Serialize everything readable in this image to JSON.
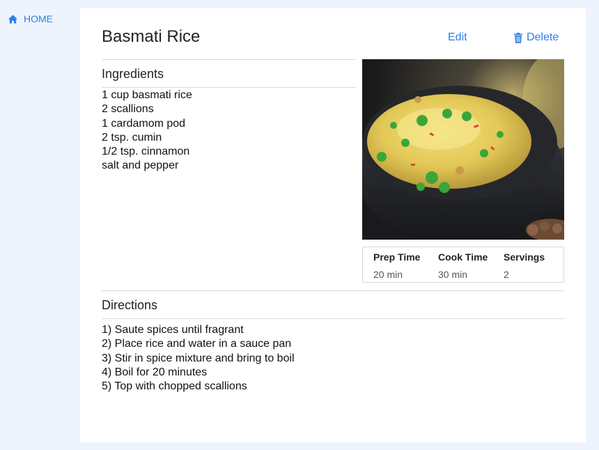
{
  "nav": {
    "home_label": "HOME"
  },
  "recipe": {
    "title": "Basmati Rice",
    "edit_label": "Edit",
    "delete_label": "Delete",
    "ingredients_heading": "Ingredients",
    "ingredients": [
      "1 cup basmati rice",
      "2 scallions",
      "1 cardamom pod",
      "2 tsp. cumin",
      "1/2 tsp. cinnamon",
      "salt and pepper"
    ],
    "stats": {
      "prep_label": "Prep Time",
      "prep_value": "20 min",
      "cook_label": "Cook Time",
      "cook_value": "30 min",
      "servings_label": "Servings",
      "servings_value": "2"
    },
    "directions_heading": "Directions",
    "directions": [
      "1) Saute spices until fragrant",
      "2) Place rice and water in a sauce pan",
      "3) Stir in spice mixture and bring to boil",
      "4) Boil for 20 minutes",
      "5) Top with chopped scallions"
    ]
  },
  "icons": {
    "home": "home-icon",
    "delete": "trash-icon"
  },
  "colors": {
    "accent": "#2f80e4",
    "page_background": "#eef4fd",
    "card_background": "#ffffff"
  }
}
